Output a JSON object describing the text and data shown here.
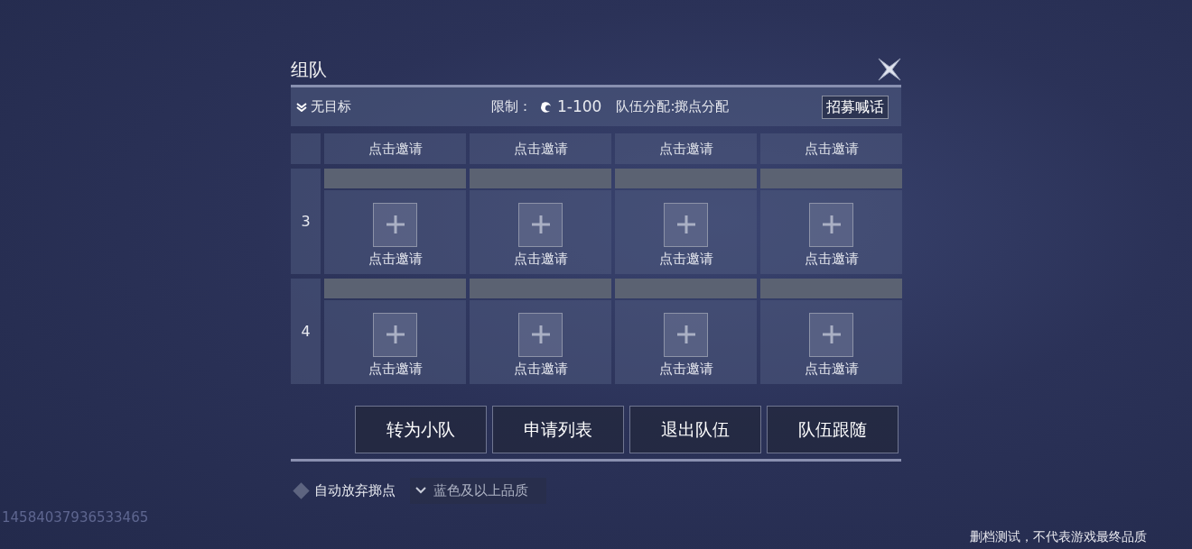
{
  "window": {
    "title": "组队"
  },
  "header": {
    "target": "无目标",
    "limit_label": "限制：",
    "level_range": "1-100",
    "distribution": "队伍分配:掷点分配",
    "recruit_button": "招募喊话"
  },
  "top_row": [
    "点击邀请",
    "点击邀请",
    "点击邀请",
    "点击邀请"
  ],
  "groups": [
    {
      "label": "3",
      "slots": [
        "点击邀请",
        "点击邀请",
        "点击邀请",
        "点击邀请"
      ]
    },
    {
      "label": "4",
      "slots": [
        "点击邀请",
        "点击邀请",
        "点击邀请",
        "点击邀请"
      ]
    }
  ],
  "actions": [
    "转为小队",
    "申请列表",
    "退出队伍",
    "队伍跟随"
  ],
  "auto_pass": {
    "label": "自动放弃掷点",
    "checked": false
  },
  "quality_select": {
    "value": "蓝色及以上品质"
  },
  "uid": "14584037936533465",
  "footer_notice": "删档测试，不代表游戏最终品质"
}
